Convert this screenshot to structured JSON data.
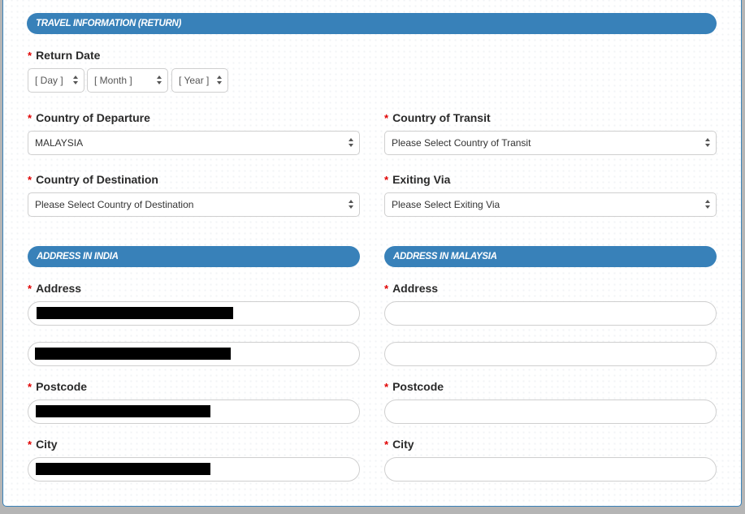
{
  "sections": {
    "travel_return": "TRAVEL INFORMATION (RETURN)",
    "address_india": "ADDRESS IN INDIA",
    "address_malaysia": "ADDRESS IN MALAYSIA"
  },
  "required_marker": "*",
  "return_date": {
    "label": "Return Date",
    "day": "[ Day ]",
    "month": "[ Month ]",
    "year": "[ Year ]"
  },
  "country_of_departure": {
    "label": "Country of Departure",
    "value": "MALAYSIA"
  },
  "country_of_transit": {
    "label": "Country of Transit",
    "value": "Please Select Country of Transit"
  },
  "country_of_destination": {
    "label": "Country of Destination",
    "value": "Please Select Country of Destination"
  },
  "exiting_via": {
    "label": "Exiting Via",
    "value": "Please Select Exiting Via"
  },
  "india_address": {
    "address_label": "Address",
    "address_line1": "[redacted]",
    "address_line2": "[redacted]",
    "postcode_label": "Postcode",
    "postcode": "[redacted]",
    "city_label": "City",
    "city": "[redacted]"
  },
  "malaysia_address": {
    "address_label": "Address",
    "address_line1": "",
    "address_line2": "",
    "postcode_label": "Postcode",
    "postcode": "",
    "city_label": "City",
    "city": ""
  },
  "colors": {
    "accent": "#3881b9",
    "required": "#e10000"
  }
}
